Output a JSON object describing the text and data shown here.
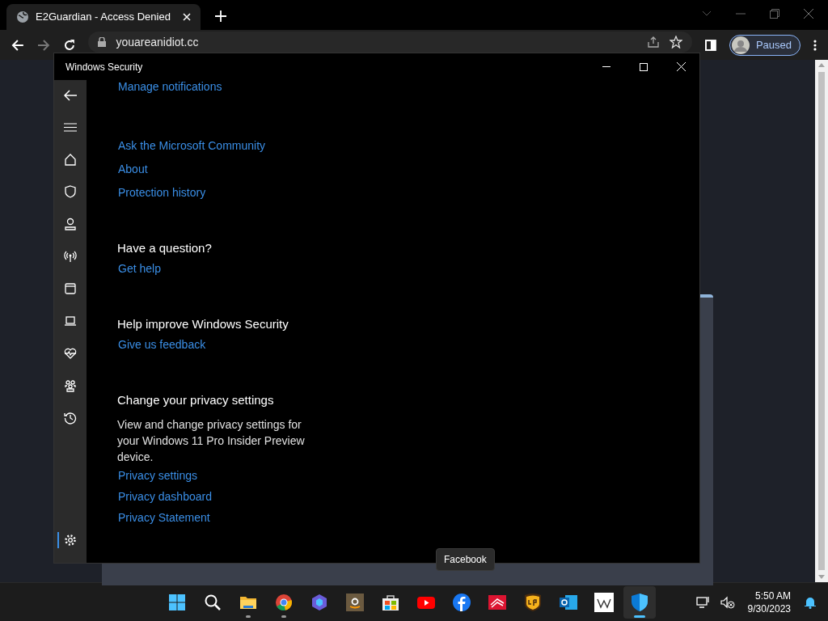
{
  "browser": {
    "tab_title": "E2Guardian - Access Denied",
    "url": "youareanidiot.cc",
    "profile_label": "Paused"
  },
  "window": {
    "title": "Windows Security"
  },
  "sidebar": {
    "items": [
      {
        "kind": "home",
        "selected": false
      },
      {
        "kind": "shield",
        "selected": false
      },
      {
        "kind": "person",
        "selected": false
      },
      {
        "kind": "antenna",
        "selected": false
      },
      {
        "kind": "browser",
        "selected": false
      },
      {
        "kind": "laptop",
        "selected": false
      },
      {
        "kind": "heart",
        "selected": false
      },
      {
        "kind": "family",
        "selected": false
      },
      {
        "kind": "history",
        "selected": false
      },
      {
        "kind": "gear",
        "selected": true
      }
    ]
  },
  "content": {
    "top_link": "Manage notifications",
    "links": [
      "Ask the Microsoft Community",
      "About",
      "Protection history"
    ],
    "sections": [
      {
        "heading": "Have a question?",
        "links": [
          "Get help"
        ]
      },
      {
        "heading": "Help improve Windows Security",
        "links": [
          "Give us feedback"
        ]
      },
      {
        "heading": "Change your privacy settings",
        "text": "View and change privacy settings for your Windows 11 Pro Insider Preview device.",
        "links": [
          "Privacy settings",
          "Privacy dashboard",
          "Privacy Statement"
        ]
      }
    ]
  },
  "taskbar": {
    "apps": [
      {
        "kind": "start",
        "running": false,
        "selected": false
      },
      {
        "kind": "search",
        "running": false,
        "selected": false
      },
      {
        "kind": "folder",
        "running": true,
        "selected": false
      },
      {
        "kind": "chrome",
        "running": true,
        "selected": false
      },
      {
        "kind": "copilot",
        "running": false,
        "selected": false
      },
      {
        "kind": "amazon",
        "running": false,
        "selected": false
      },
      {
        "kind": "store",
        "running": false,
        "selected": false
      },
      {
        "kind": "youtube",
        "running": false,
        "selected": false
      },
      {
        "kind": "facebook",
        "running": false,
        "selected": false
      },
      {
        "kind": "bank",
        "running": false,
        "selected": false
      },
      {
        "kind": "ups",
        "running": false,
        "selected": false
      },
      {
        "kind": "outlook",
        "running": false,
        "selected": false
      },
      {
        "kind": "wiki",
        "running": false,
        "selected": false
      },
      {
        "kind": "security",
        "running": true,
        "selected": true
      }
    ],
    "tooltip": "Facebook",
    "time": "5:50 AM",
    "date": "9/30/2023"
  }
}
